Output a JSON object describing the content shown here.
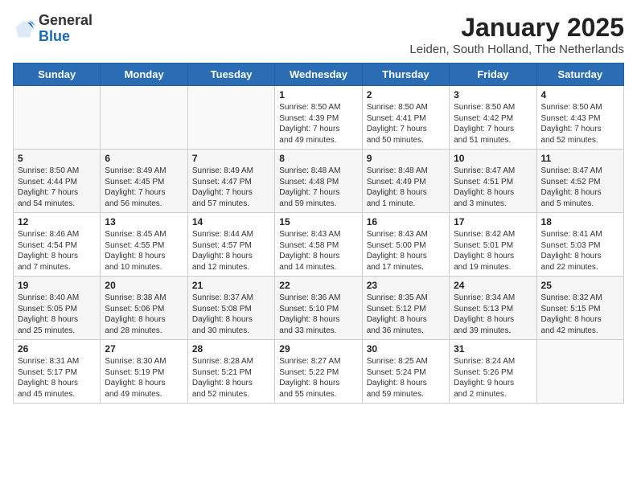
{
  "header": {
    "logo_general": "General",
    "logo_blue": "Blue",
    "month": "January 2025",
    "location": "Leiden, South Holland, The Netherlands"
  },
  "days_of_week": [
    "Sunday",
    "Monday",
    "Tuesday",
    "Wednesday",
    "Thursday",
    "Friday",
    "Saturday"
  ],
  "weeks": [
    [
      {
        "day": "",
        "content": ""
      },
      {
        "day": "",
        "content": ""
      },
      {
        "day": "",
        "content": ""
      },
      {
        "day": "1",
        "content": "Sunrise: 8:50 AM\nSunset: 4:39 PM\nDaylight: 7 hours\nand 49 minutes."
      },
      {
        "day": "2",
        "content": "Sunrise: 8:50 AM\nSunset: 4:41 PM\nDaylight: 7 hours\nand 50 minutes."
      },
      {
        "day": "3",
        "content": "Sunrise: 8:50 AM\nSunset: 4:42 PM\nDaylight: 7 hours\nand 51 minutes."
      },
      {
        "day": "4",
        "content": "Sunrise: 8:50 AM\nSunset: 4:43 PM\nDaylight: 7 hours\nand 52 minutes."
      }
    ],
    [
      {
        "day": "5",
        "content": "Sunrise: 8:50 AM\nSunset: 4:44 PM\nDaylight: 7 hours\nand 54 minutes."
      },
      {
        "day": "6",
        "content": "Sunrise: 8:49 AM\nSunset: 4:45 PM\nDaylight: 7 hours\nand 56 minutes."
      },
      {
        "day": "7",
        "content": "Sunrise: 8:49 AM\nSunset: 4:47 PM\nDaylight: 7 hours\nand 57 minutes."
      },
      {
        "day": "8",
        "content": "Sunrise: 8:48 AM\nSunset: 4:48 PM\nDaylight: 7 hours\nand 59 minutes."
      },
      {
        "day": "9",
        "content": "Sunrise: 8:48 AM\nSunset: 4:49 PM\nDaylight: 8 hours\nand 1 minute."
      },
      {
        "day": "10",
        "content": "Sunrise: 8:47 AM\nSunset: 4:51 PM\nDaylight: 8 hours\nand 3 minutes."
      },
      {
        "day": "11",
        "content": "Sunrise: 8:47 AM\nSunset: 4:52 PM\nDaylight: 8 hours\nand 5 minutes."
      }
    ],
    [
      {
        "day": "12",
        "content": "Sunrise: 8:46 AM\nSunset: 4:54 PM\nDaylight: 8 hours\nand 7 minutes."
      },
      {
        "day": "13",
        "content": "Sunrise: 8:45 AM\nSunset: 4:55 PM\nDaylight: 8 hours\nand 10 minutes."
      },
      {
        "day": "14",
        "content": "Sunrise: 8:44 AM\nSunset: 4:57 PM\nDaylight: 8 hours\nand 12 minutes."
      },
      {
        "day": "15",
        "content": "Sunrise: 8:43 AM\nSunset: 4:58 PM\nDaylight: 8 hours\nand 14 minutes."
      },
      {
        "day": "16",
        "content": "Sunrise: 8:43 AM\nSunset: 5:00 PM\nDaylight: 8 hours\nand 17 minutes."
      },
      {
        "day": "17",
        "content": "Sunrise: 8:42 AM\nSunset: 5:01 PM\nDaylight: 8 hours\nand 19 minutes."
      },
      {
        "day": "18",
        "content": "Sunrise: 8:41 AM\nSunset: 5:03 PM\nDaylight: 8 hours\nand 22 minutes."
      }
    ],
    [
      {
        "day": "19",
        "content": "Sunrise: 8:40 AM\nSunset: 5:05 PM\nDaylight: 8 hours\nand 25 minutes."
      },
      {
        "day": "20",
        "content": "Sunrise: 8:38 AM\nSunset: 5:06 PM\nDaylight: 8 hours\nand 28 minutes."
      },
      {
        "day": "21",
        "content": "Sunrise: 8:37 AM\nSunset: 5:08 PM\nDaylight: 8 hours\nand 30 minutes."
      },
      {
        "day": "22",
        "content": "Sunrise: 8:36 AM\nSunset: 5:10 PM\nDaylight: 8 hours\nand 33 minutes."
      },
      {
        "day": "23",
        "content": "Sunrise: 8:35 AM\nSunset: 5:12 PM\nDaylight: 8 hours\nand 36 minutes."
      },
      {
        "day": "24",
        "content": "Sunrise: 8:34 AM\nSunset: 5:13 PM\nDaylight: 8 hours\nand 39 minutes."
      },
      {
        "day": "25",
        "content": "Sunrise: 8:32 AM\nSunset: 5:15 PM\nDaylight: 8 hours\nand 42 minutes."
      }
    ],
    [
      {
        "day": "26",
        "content": "Sunrise: 8:31 AM\nSunset: 5:17 PM\nDaylight: 8 hours\nand 45 minutes."
      },
      {
        "day": "27",
        "content": "Sunrise: 8:30 AM\nSunset: 5:19 PM\nDaylight: 8 hours\nand 49 minutes."
      },
      {
        "day": "28",
        "content": "Sunrise: 8:28 AM\nSunset: 5:21 PM\nDaylight: 8 hours\nand 52 minutes."
      },
      {
        "day": "29",
        "content": "Sunrise: 8:27 AM\nSunset: 5:22 PM\nDaylight: 8 hours\nand 55 minutes."
      },
      {
        "day": "30",
        "content": "Sunrise: 8:25 AM\nSunset: 5:24 PM\nDaylight: 8 hours\nand 59 minutes."
      },
      {
        "day": "31",
        "content": "Sunrise: 8:24 AM\nSunset: 5:26 PM\nDaylight: 9 hours\nand 2 minutes."
      },
      {
        "day": "",
        "content": ""
      }
    ]
  ]
}
